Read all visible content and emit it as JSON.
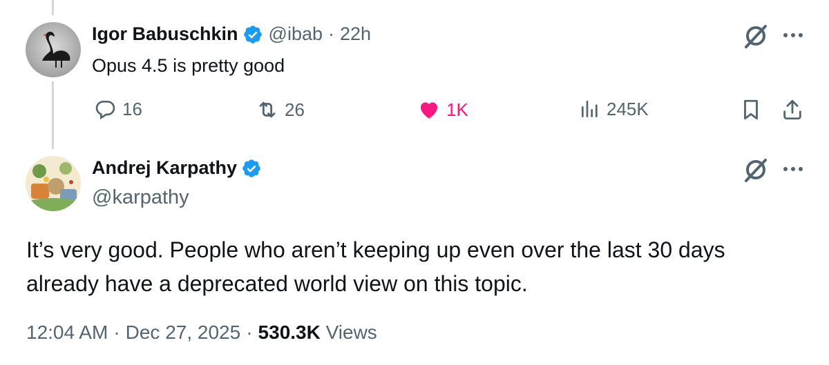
{
  "colors": {
    "text_primary": "#0f1419",
    "text_secondary": "#536471",
    "verified_blue": "#1d9bf0",
    "like_pink": "#f91880",
    "thread_line": "#cfd9de"
  },
  "parent_tweet": {
    "name": "Igor Babuschkin",
    "handle": "@ibab",
    "separator": "·",
    "time": "22h",
    "text": "Opus 4.5 is pretty good",
    "actions": {
      "replies": "16",
      "reposts": "26",
      "likes": "1K",
      "views": "245K"
    },
    "icons": [
      "reply-icon",
      "repost-icon",
      "like-icon",
      "views-icon",
      "bookmark-icon",
      "share-icon",
      "grok-icon",
      "more-icon",
      "verified-icon"
    ]
  },
  "main_tweet": {
    "name": "Andrej Karpathy",
    "handle": "@karpathy",
    "text": "It’s very good. People who aren’t keeping up even over the last 30 days already have a deprecated world view on this topic.",
    "footer": {
      "time": "12:04 AM",
      "date": "Dec 27, 2025",
      "separator": "·",
      "views_count": "530.3K",
      "views_label": "Views"
    }
  }
}
